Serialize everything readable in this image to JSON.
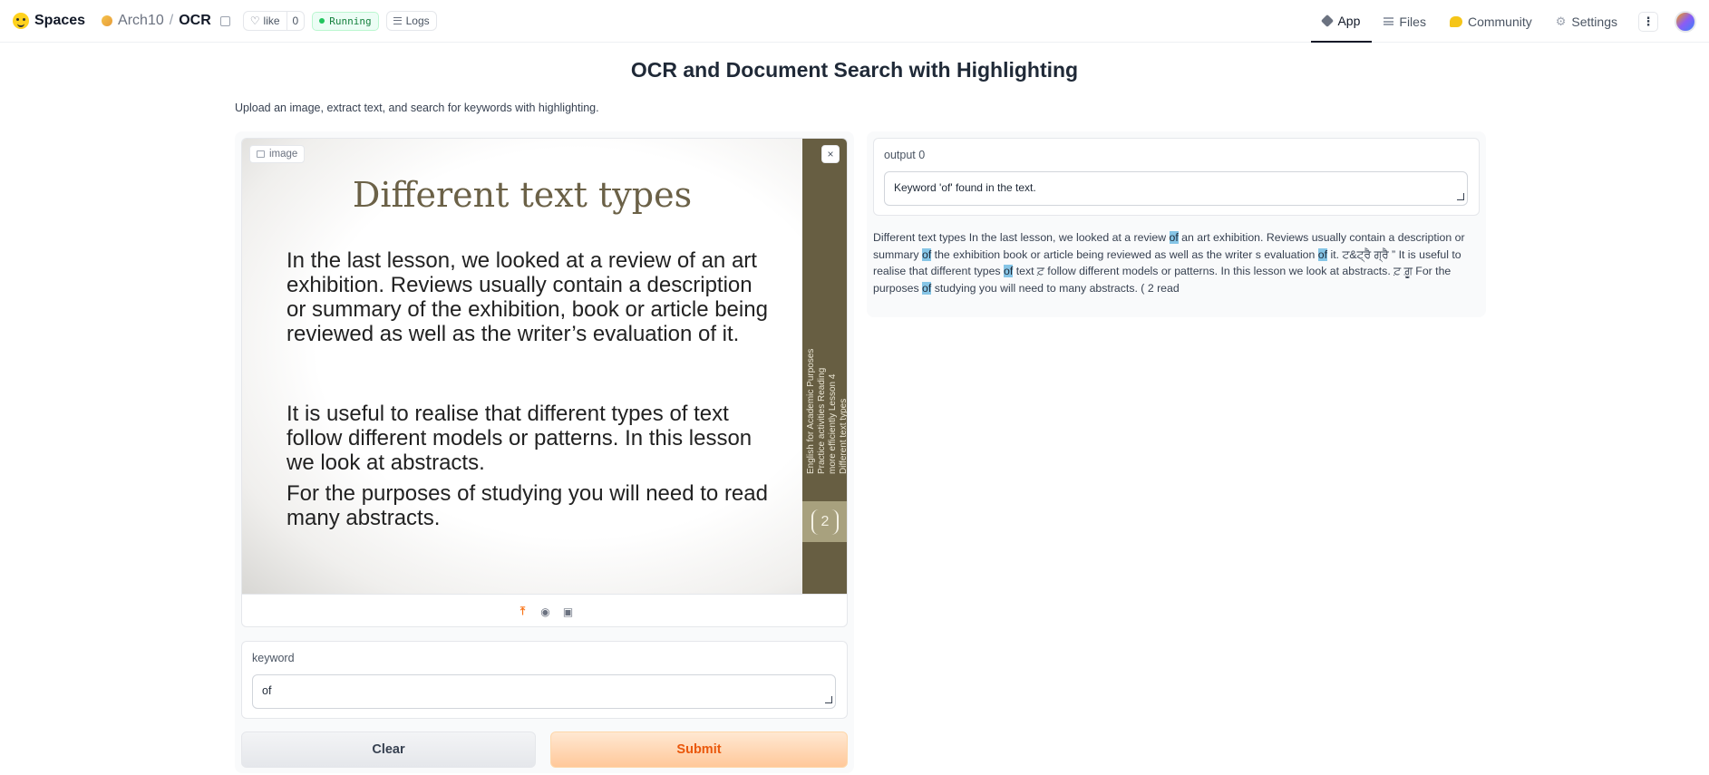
{
  "topbar": {
    "brand": "Spaces",
    "owner": "Arch10",
    "separator": "/",
    "repo": "OCR",
    "like_label": "like",
    "like_count": "0",
    "status": "Running",
    "logs_label": "Logs",
    "nav": {
      "app": "App",
      "files": "Files",
      "community": "Community",
      "settings": "Settings",
      "more": "⋮"
    }
  },
  "page": {
    "title": "OCR and Document Search with Highlighting",
    "description": "Upload an image, extract text, and search for keywords with highlighting."
  },
  "image_input": {
    "label": "image",
    "slide": {
      "title": "Different text types",
      "para1": "In the last lesson, we looked at a review of an art exhibition. Reviews usually contain a description or summary  of the exhibition, book or article being reviewed as well as the writer’s evaluation of it.",
      "para2": "It is useful to realise that different types of text follow different models or patterns. In this lesson we look at abstracts.",
      "para3": "For the purposes of studying you will need to read many abstracts.",
      "sidebar_text": "English for Academic Purposes Practice activities Reading more efficiently Lesson 4 Different text types",
      "page_number": "2"
    },
    "close": "×"
  },
  "keyword": {
    "label": "keyword",
    "value": "of"
  },
  "buttons": {
    "clear": "Clear",
    "submit": "Submit"
  },
  "output": {
    "label": "output 0",
    "value": "Keyword 'of' found in the text.",
    "highlighted_segments": [
      "Different text types In the last lesson, we looked at a review ",
      "of",
      " an art exhibition. Reviews usually contain a description or summary ",
      "of",
      " the exhibition book or article being reviewed as well as the writer s evaluation ",
      "of",
      " it. ਟ&ਟ੍ਰੈ ਗ੍ਰੈ ” It is useful to realise that different types ",
      "of",
      " text ਟ਼ follow different models or patterns. In this lesson we look at abstracts. ਟ਼ ਗ਼ੂ For the purposes ",
      "of",
      " studying you will need to many abstracts. ( 2 read"
    ]
  },
  "colors": {
    "accent": "#ea580c",
    "highlight": "#86c5e6",
    "slide_band": "#675e42",
    "status_green": "#15803d"
  }
}
